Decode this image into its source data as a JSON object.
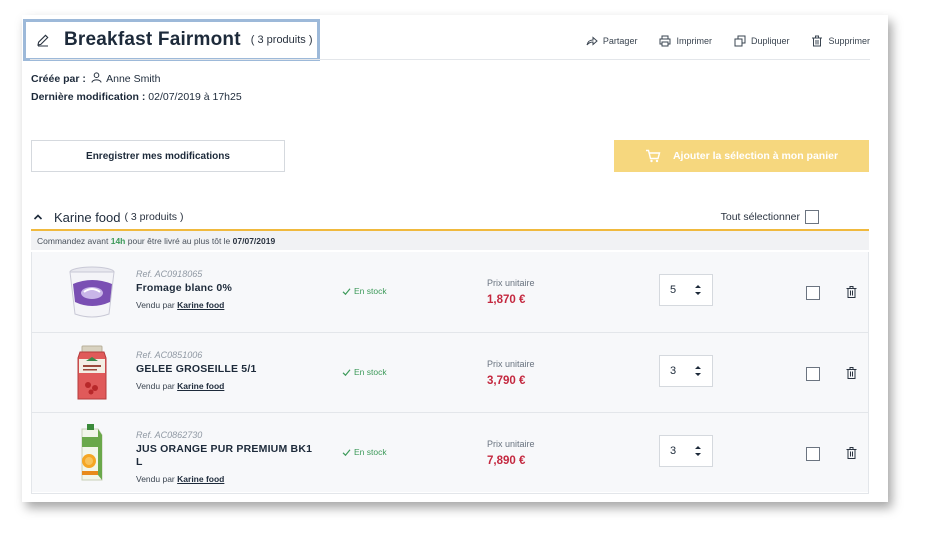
{
  "header": {
    "title": "Breakfast Fairmont",
    "count": "( 3 produits )",
    "actions": [
      {
        "label": "Partager",
        "icon": "share-icon"
      },
      {
        "label": "Imprimer",
        "icon": "print-icon"
      },
      {
        "label": "Dupliquer",
        "icon": "duplicate-icon"
      },
      {
        "label": "Supprimer",
        "icon": "trash-icon"
      }
    ]
  },
  "meta": {
    "created_label": "Créée par :",
    "created_by": "Anne Smith",
    "modified_label": "Dernière modification :",
    "modified_value": "02/07/2019 à 17h25"
  },
  "buttons": {
    "save": "Enregistrer mes modifications",
    "add_to_cart": "Ajouter la sélection à mon panier"
  },
  "supplier": {
    "name": "Karine food",
    "count": "( 3 produits )",
    "select_all": "Tout sélectionner",
    "notice_pre": "Commandez avant",
    "notice_time": "14h",
    "notice_mid": "pour être livré au plus tôt le",
    "notice_date": "07/07/2019"
  },
  "products": [
    {
      "ref": "Ref. AC0918065",
      "name": "Fromage blanc 0%",
      "vendor_label": "Vendu par",
      "vendor": "Karine food",
      "stock": "En stock",
      "price_label": "Prix unitaire",
      "price": "1,870 €",
      "qty": "5",
      "selected": false
    },
    {
      "ref": "Ref. AC0851006",
      "name": "GELEE GROSEILLE 5/1",
      "vendor_label": "Vendu par",
      "vendor": "Karine food",
      "stock": "En stock",
      "price_label": "Prix unitaire",
      "price": "3,790 €",
      "qty": "3",
      "selected": false
    },
    {
      "ref": "Ref. AC0862730",
      "name": "JUS ORANGE PUR PREMIUM BK1 L",
      "vendor_label": "Vendu par",
      "vendor": "Karine food",
      "stock": "En stock",
      "price_label": "Prix unitaire",
      "price": "7,890 €",
      "qty": "3",
      "selected": false
    }
  ],
  "colors": {
    "accent": "#f0b93d",
    "cart_button": "#f6d77e",
    "price": "#c4283f",
    "in_stock": "#3d9a5a",
    "title_highlight": "#9db9d9"
  }
}
